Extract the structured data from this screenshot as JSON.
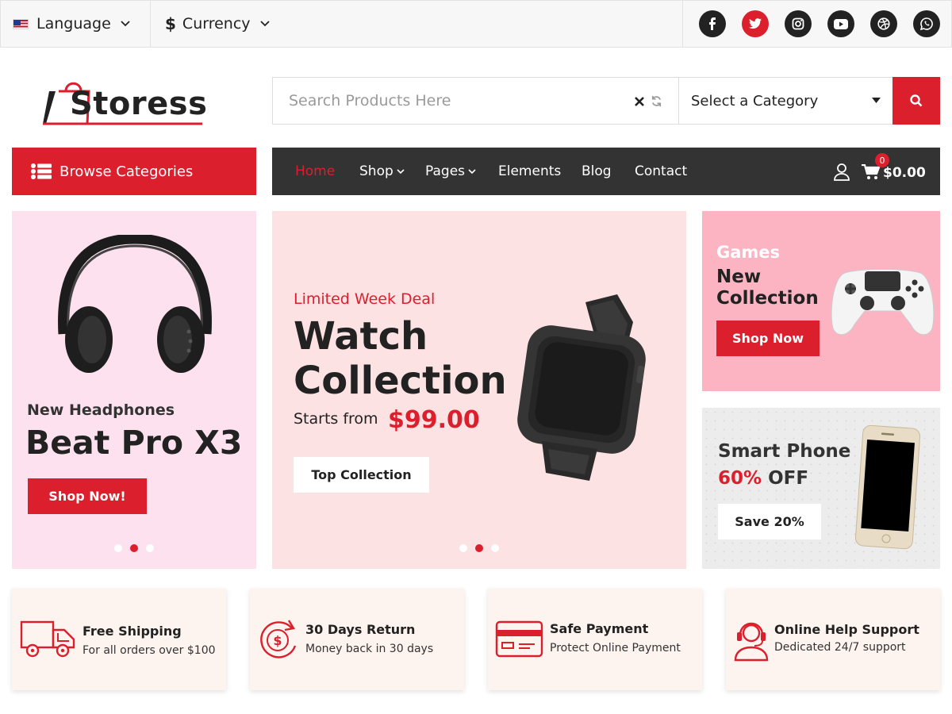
{
  "topbar": {
    "language_label": "Language",
    "currency_label": "Currency",
    "currency_symbol": "$"
  },
  "social_icons": [
    "facebook-icon",
    "twitter-icon",
    "instagram-icon",
    "youtube-icon",
    "dribbble-icon",
    "whatsapp-icon"
  ],
  "brand": {
    "name": "Storess",
    "accent": "#dc1f2d",
    "dark": "#333333"
  },
  "search": {
    "placeholder": "Search Products Here",
    "category_selected": "Select a Category"
  },
  "browse": {
    "label": "Browse Categories"
  },
  "nav": {
    "items": [
      {
        "label": "Home",
        "active": true
      },
      {
        "label": "Shop",
        "dropdown": true
      },
      {
        "label": "Pages",
        "dropdown": true
      },
      {
        "label": "Elements"
      },
      {
        "label": "Blog"
      },
      {
        "label": "Contact"
      }
    ],
    "cart_count": "0",
    "cart_total": "$0.00"
  },
  "banners": {
    "headphones": {
      "subtitle": "New Headphones",
      "title": "Beat Pro X3",
      "button": "Shop Now!",
      "active_slide": 2,
      "slides": 3
    },
    "watch": {
      "kicker": "Limited Week Deal",
      "title_line1": "Watch",
      "title_line2": "Collection",
      "starts_from": "Starts from",
      "price": "$99.00",
      "button": "Top Collection",
      "active_slide": 2,
      "slides": 3
    },
    "games": {
      "kicker": "Games",
      "title_line1": "New",
      "title_line2": "Collection",
      "button": "Shop Now"
    },
    "phone": {
      "title": "Smart Phone",
      "discount": "60%",
      "discount_suffix": " OFF",
      "button": "Save 20%"
    }
  },
  "features": [
    {
      "icon": "truck-icon",
      "title": "Free Shipping",
      "subtitle": "For all orders over $100"
    },
    {
      "icon": "money-return-icon",
      "title": "30 Days Return",
      "subtitle": "Money back in 30 days"
    },
    {
      "icon": "credit-card-icon",
      "title": "Safe Payment",
      "subtitle": "Protect Online Payment"
    },
    {
      "icon": "headset-support-icon",
      "title": "Online Help Support",
      "subtitle": "Dedicated 24/7 support"
    }
  ]
}
